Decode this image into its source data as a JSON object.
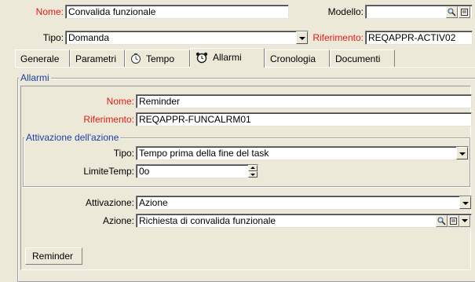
{
  "header": {
    "nome_label": "Nome:",
    "nome_value": "Convalida funzionale",
    "modello_label": "Modello:",
    "modello_value": "",
    "tipo_label": "Tipo:",
    "tipo_value": "Domanda",
    "riferimento_label": "Riferimento:",
    "riferimento_value": "REQAPPR-ACTIV02"
  },
  "tabs": [
    {
      "label": "Generale",
      "icon": null
    },
    {
      "label": "Parametri",
      "icon": null
    },
    {
      "label": "Tempo",
      "icon": "clock-icon"
    },
    {
      "label": "Allarmi",
      "icon": "alarm-clock-icon",
      "active": true
    },
    {
      "label": "Cronologia",
      "icon": null
    },
    {
      "label": "Documenti",
      "icon": null
    }
  ],
  "alarm_panel": {
    "group_title": "Allarmi",
    "nome_label": "Nome:",
    "nome_value": "Reminder",
    "riferimento_label": "Riferimento:",
    "riferimento_value": "REQAPPR-FUNCALRM01",
    "activation_group": {
      "title": "Attivazione dell'azione",
      "tipo_label": "Tipo:",
      "tipo_value": "Tempo prima della fine del task",
      "limite_label": "LimiteTemp:",
      "limite_value": "0o"
    },
    "attivazione_label": "Attivazione:",
    "attivazione_value": "Azione",
    "azione_label": "Azione:",
    "azione_value": "Richiesta di convalida funzionale",
    "bottom_tab": "Reminder"
  },
  "colors": {
    "required_label": "#e31a1a",
    "group_title": "#1b3fa8",
    "background": "#ece9d8"
  }
}
